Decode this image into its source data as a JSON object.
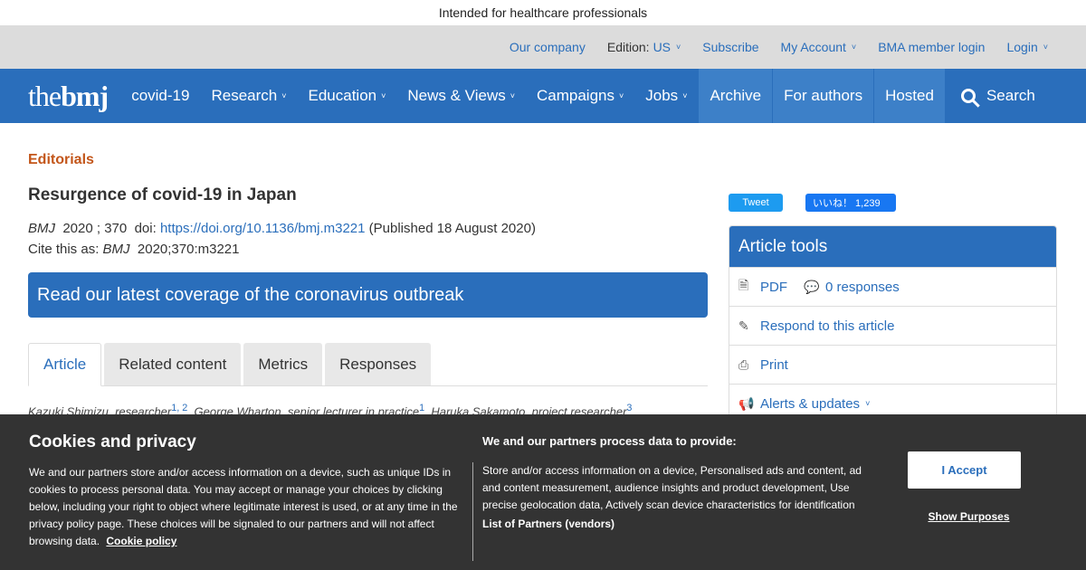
{
  "hcp_notice": "Intended for healthcare professionals",
  "utility_bar": {
    "our_company": "Our company",
    "edition_label": "Edition:",
    "edition_value": "US",
    "subscribe": "Subscribe",
    "my_account": "My Account",
    "bma_login": "BMA member login",
    "login": "Login"
  },
  "nav": {
    "logo_the": "the",
    "logo_bmj": "bmj",
    "items": [
      "covid-19",
      "Research",
      "Education",
      "News & Views",
      "Campaigns",
      "Jobs"
    ],
    "alt_items": [
      "Archive",
      "For authors",
      "Hosted"
    ],
    "search": "Search"
  },
  "article": {
    "section": "Editorials",
    "title": "Resurgence of covid-19 in Japan",
    "journal": "BMJ",
    "year_vol": "2020 ; 370",
    "doi_label": "doi:",
    "doi_link": "https://doi.org/10.1136/bmj.m3221",
    "published": "(Published 18 August 2020)",
    "cite_label": "Cite this as:",
    "cite_journal": "BMJ",
    "cite_ref": "2020;370:m3221",
    "banner": "Read our latest coverage of the coronavirus outbreak",
    "tabs": [
      "Article",
      "Related content",
      "Metrics",
      "Responses"
    ],
    "authors_line": "Kazuki Shimizu, researcher",
    "authors_sup1": "1, 2",
    "author2": "George Wharton, senior lecturer in practice",
    "authors_sup2": "1",
    "author3": "Haruka Sakamoto, project researcher",
    "authors_sup3": "3"
  },
  "social": {
    "tweet": "Tweet",
    "like": "いいね！ 1,239"
  },
  "tools": {
    "title": "Article tools",
    "pdf": "PDF",
    "responses": "0 responses",
    "respond": "Respond to this article",
    "print": "Print",
    "alerts": "Alerts & updates"
  },
  "cookie": {
    "title": "Cookies and privacy",
    "text": "We and our partners store and/or access information on a device, such as unique IDs in cookies to process personal data. You may accept or manage your choices by clicking below, including your right to object where legitimate interest is used, or at any time in the privacy policy page. These choices will be signaled to our partners and will not affect browsing data.",
    "policy_link": "Cookie policy",
    "process_title": "We and our partners process data to provide:",
    "process_text": "Store and/or access information on a device, Personalised ads and content, ad and content measurement, audience insights and product development, Use precise geolocation data, Actively scan device characteristics for identification",
    "vendors": "List of Partners (vendors)",
    "accept": "I Accept",
    "purposes": "Show Purposes"
  },
  "colors": {
    "brand_blue": "#2a6ebb",
    "section_orange": "#c3561a",
    "cookie_bg": "#333333"
  }
}
